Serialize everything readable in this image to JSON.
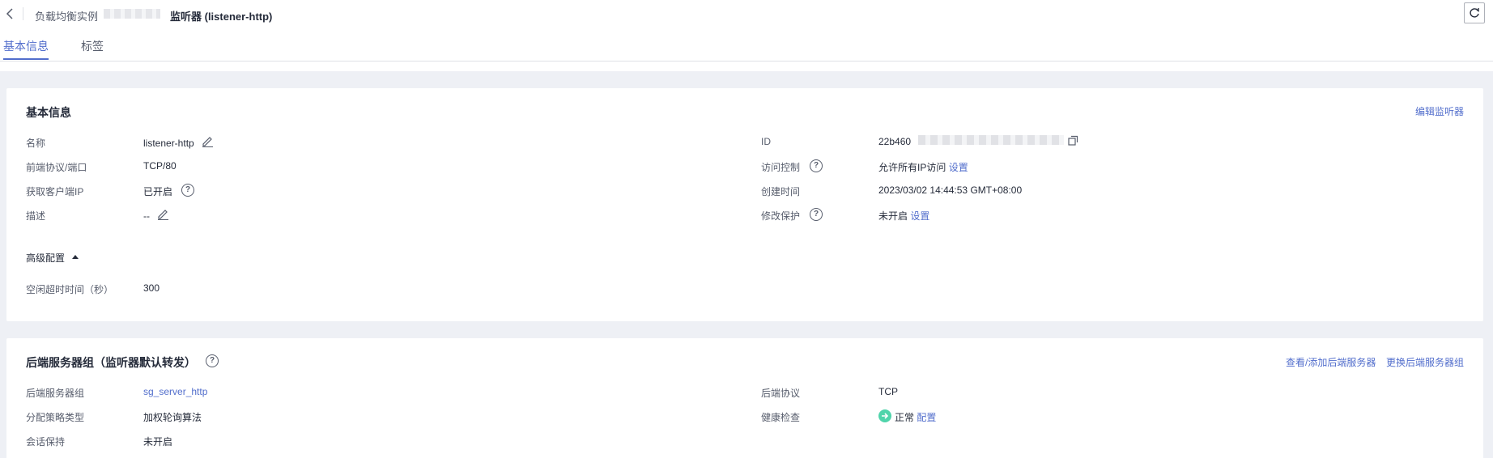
{
  "header": {
    "breadcrumb_parent": "负载均衡实例",
    "title": "监听器 (listener-http)"
  },
  "tabs": [
    {
      "label": "基本信息",
      "active": true
    },
    {
      "label": "标签",
      "active": false
    }
  ],
  "basic_info": {
    "title": "基本信息",
    "edit_link": "编辑监听器",
    "left": {
      "name_label": "名称",
      "name_value": "listener-http",
      "protocol_label": "前端协议/端口",
      "protocol_value": "TCP/80",
      "client_ip_label": "获取客户端IP",
      "client_ip_value": "已开启",
      "desc_label": "描述",
      "desc_value": "--"
    },
    "right": {
      "id_label": "ID",
      "id_value_visible": "22b460",
      "access_label": "访问控制",
      "access_value": "允许所有IP访问",
      "access_link": "设置",
      "created_label": "创建时间",
      "created_value": "2023/03/02 14:44:53 GMT+08:00",
      "protect_label": "修改保护",
      "protect_value": "未开启",
      "protect_link": "设置"
    },
    "advanced": {
      "toggle_label": "高级配置",
      "idle_label": "空闲超时时间（秒）",
      "idle_value": "300"
    }
  },
  "backend": {
    "title": "后端服务器组（监听器默认转发）",
    "link_view_add": "查看/添加后端服务器",
    "link_change": "更换后端服务器组",
    "group_label": "后端服务器组",
    "group_value": "sg_server_http",
    "policy_label": "分配策略类型",
    "policy_value": "加权轮询算法",
    "session_label": "会话保持",
    "session_value": "未开启",
    "proto_label": "后端协议",
    "proto_value": "TCP",
    "health_label": "健康检查",
    "health_value": "正常",
    "health_link": "配置"
  },
  "colors": {
    "accent": "#526ecc",
    "healthy": "#50d4ab"
  }
}
